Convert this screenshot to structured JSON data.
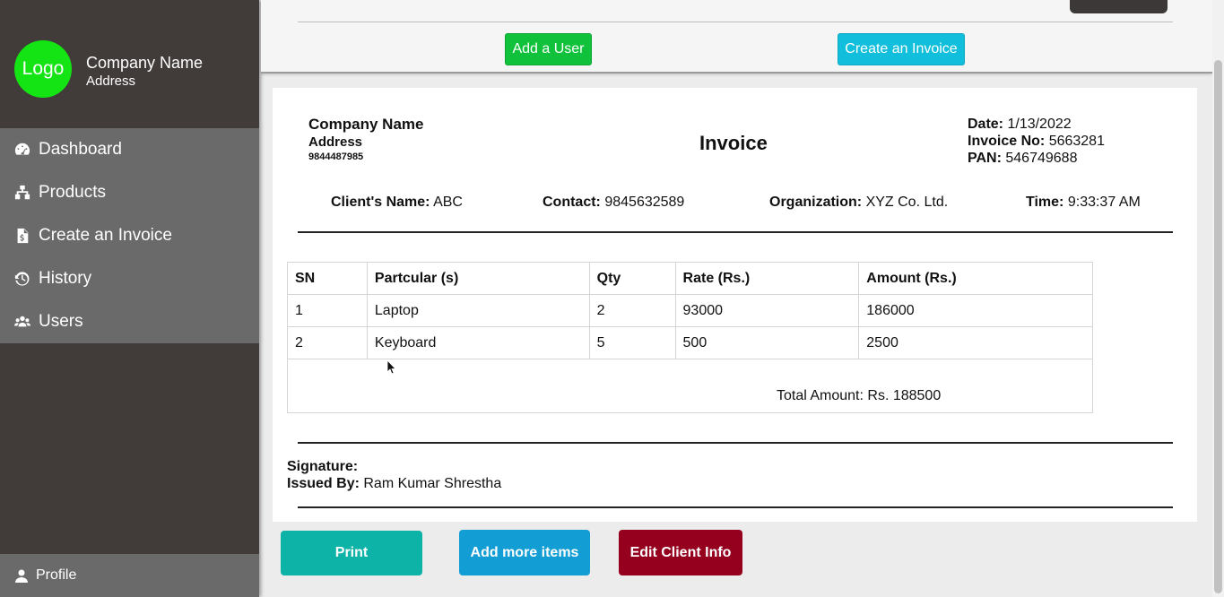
{
  "sidebar": {
    "logo_text": "Logo",
    "company_name": "Company Name",
    "company_address": "Address",
    "items": [
      {
        "label": "Dashboard",
        "icon": "tachometer-icon"
      },
      {
        "label": "Products",
        "icon": "sitemap-icon"
      },
      {
        "label": "Create an Invoice",
        "icon": "file-invoice-icon"
      },
      {
        "label": "History",
        "icon": "history-icon"
      },
      {
        "label": "Users",
        "icon": "users-icon"
      }
    ],
    "profile_label": "Profile"
  },
  "topbar": {
    "add_user_label": "Add a User",
    "create_invoice_label": "Create an Invoice"
  },
  "invoice": {
    "title": "Invoice",
    "company_name": "Company Name",
    "company_address": "Address",
    "company_phone": "9844487985",
    "date_label": "Date:",
    "date": "1/13/2022",
    "invoice_no_label": "Invoice No:",
    "invoice_no": "5663281",
    "pan_label": "PAN:",
    "pan": "546749688",
    "client_name_label": "Client's Name:",
    "client_name": "ABC",
    "contact_label": "Contact:",
    "contact": "9845632589",
    "organization_label": "Organization:",
    "organization": "XYZ Co. Ltd.",
    "time_label": "Time:",
    "time": "9:33:37 AM",
    "table": {
      "headers": [
        "SN",
        "Partcular (s)",
        "Qty",
        "Rate (Rs.)",
        "Amount (Rs.)"
      ],
      "rows": [
        [
          "1",
          "Laptop",
          "2",
          "93000",
          "186000"
        ],
        [
          "2",
          "Keyboard",
          "5",
          "500",
          "2500"
        ]
      ],
      "total_text": "Total Amount: Rs. 188500"
    },
    "signature_label": "Signature:",
    "issued_by_label": "Issued By:",
    "issued_by": "Ram Kumar Shrestha"
  },
  "actions": {
    "print_label": "Print",
    "add_more_label": "Add more items",
    "edit_client_label": "Edit Client Info"
  },
  "colors": {
    "sidebar_bg": "#413b3a",
    "nav_bg": "#6a6a6a",
    "logo_green": "#14e414",
    "add_user_green": "#10c13b",
    "create_invoice_cyan": "#11bedb",
    "print_teal": "#0eb3a7",
    "add_more_blue": "#129ed4",
    "edit_client_red": "#96001f"
  }
}
